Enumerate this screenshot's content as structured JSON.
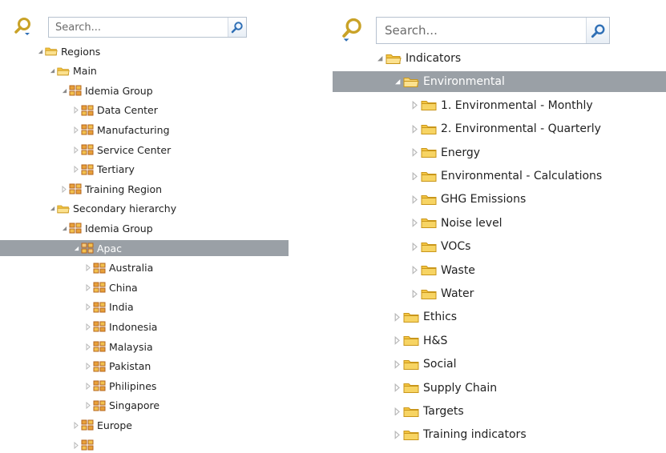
{
  "left": {
    "search": {
      "placeholder": "Search..."
    },
    "rows": [
      {
        "label": "Regions",
        "depth": 0,
        "expanded": true,
        "selected": false,
        "icon": "folder-open-icon"
      },
      {
        "label": "Main",
        "depth": 1,
        "expanded": true,
        "selected": false,
        "icon": "folder-open-icon"
      },
      {
        "label": "Idemia Group",
        "depth": 2,
        "expanded": true,
        "selected": false,
        "icon": "org-unit-icon"
      },
      {
        "label": "Data Center",
        "depth": 3,
        "expanded": false,
        "selected": false,
        "icon": "org-unit-icon"
      },
      {
        "label": "Manufacturing",
        "depth": 3,
        "expanded": false,
        "selected": false,
        "icon": "org-unit-icon"
      },
      {
        "label": "Service Center",
        "depth": 3,
        "expanded": false,
        "selected": false,
        "icon": "org-unit-icon"
      },
      {
        "label": "Tertiary",
        "depth": 3,
        "expanded": false,
        "selected": false,
        "icon": "org-unit-icon"
      },
      {
        "label": "Training Region",
        "depth": 2,
        "expanded": false,
        "selected": false,
        "icon": "org-unit-icon"
      },
      {
        "label": "Secondary hierarchy",
        "depth": 1,
        "expanded": true,
        "selected": false,
        "icon": "folder-open-icon"
      },
      {
        "label": "Idemia Group",
        "depth": 2,
        "expanded": true,
        "selected": false,
        "icon": "org-unit-icon"
      },
      {
        "label": "Apac",
        "depth": 3,
        "expanded": true,
        "selected": true,
        "icon": "org-unit-icon"
      },
      {
        "label": "Australia",
        "depth": 4,
        "expanded": false,
        "selected": false,
        "icon": "org-unit-icon"
      },
      {
        "label": "China",
        "depth": 4,
        "expanded": false,
        "selected": false,
        "icon": "org-unit-icon"
      },
      {
        "label": "India",
        "depth": 4,
        "expanded": false,
        "selected": false,
        "icon": "org-unit-icon"
      },
      {
        "label": "Indonesia",
        "depth": 4,
        "expanded": false,
        "selected": false,
        "icon": "org-unit-icon"
      },
      {
        "label": "Malaysia",
        "depth": 4,
        "expanded": false,
        "selected": false,
        "icon": "org-unit-icon"
      },
      {
        "label": "Pakistan",
        "depth": 4,
        "expanded": false,
        "selected": false,
        "icon": "org-unit-icon"
      },
      {
        "label": "Philipines",
        "depth": 4,
        "expanded": false,
        "selected": false,
        "icon": "org-unit-icon"
      },
      {
        "label": "Singapore",
        "depth": 4,
        "expanded": false,
        "selected": false,
        "icon": "org-unit-icon"
      },
      {
        "label": "Europe",
        "depth": 3,
        "expanded": false,
        "selected": false,
        "icon": "org-unit-icon"
      },
      {
        "label": "",
        "depth": 3,
        "expanded": false,
        "selected": false,
        "icon": "org-unit-icon"
      }
    ]
  },
  "right": {
    "search": {
      "placeholder": "Search..."
    },
    "rows": [
      {
        "label": "Indicators",
        "depth": 0,
        "expanded": true,
        "selected": false,
        "icon": "folder-open-icon"
      },
      {
        "label": "Environmental",
        "depth": 1,
        "expanded": true,
        "selected": true,
        "icon": "folder-open-icon"
      },
      {
        "label": "1. Environmental - Monthly",
        "depth": 2,
        "expanded": false,
        "selected": false,
        "icon": "folder-icon"
      },
      {
        "label": "2. Environmental - Quarterly",
        "depth": 2,
        "expanded": false,
        "selected": false,
        "icon": "folder-icon"
      },
      {
        "label": "Energy",
        "depth": 2,
        "expanded": false,
        "selected": false,
        "icon": "folder-icon"
      },
      {
        "label": "Environmental - Calculations",
        "depth": 2,
        "expanded": false,
        "selected": false,
        "icon": "folder-icon"
      },
      {
        "label": "GHG Emissions",
        "depth": 2,
        "expanded": false,
        "selected": false,
        "icon": "folder-icon"
      },
      {
        "label": "Noise level",
        "depth": 2,
        "expanded": false,
        "selected": false,
        "icon": "folder-icon"
      },
      {
        "label": "VOCs",
        "depth": 2,
        "expanded": false,
        "selected": false,
        "icon": "folder-icon"
      },
      {
        "label": "Waste",
        "depth": 2,
        "expanded": false,
        "selected": false,
        "icon": "folder-icon"
      },
      {
        "label": "Water",
        "depth": 2,
        "expanded": false,
        "selected": false,
        "icon": "folder-icon"
      },
      {
        "label": "Ethics",
        "depth": 1,
        "expanded": false,
        "selected": false,
        "icon": "folder-icon"
      },
      {
        "label": "H&S",
        "depth": 1,
        "expanded": false,
        "selected": false,
        "icon": "folder-icon"
      },
      {
        "label": "Social",
        "depth": 1,
        "expanded": false,
        "selected": false,
        "icon": "folder-icon"
      },
      {
        "label": "Supply Chain",
        "depth": 1,
        "expanded": false,
        "selected": false,
        "icon": "folder-icon"
      },
      {
        "label": "Targets",
        "depth": 1,
        "expanded": false,
        "selected": false,
        "icon": "folder-icon"
      },
      {
        "label": "Training indicators",
        "depth": 1,
        "expanded": false,
        "selected": false,
        "icon": "folder-icon"
      }
    ]
  },
  "colors": {
    "selection": "#9aa0a6",
    "folder": "#f4c542",
    "folder_edge": "#c9961a",
    "org_unit": "#e8a13a",
    "org_unit_edge": "#b5651d",
    "twisty": "#8a8a8a",
    "search_glass": "#2f6fb5",
    "search_tool": "#c9a227"
  },
  "icons": {
    "search_tool": "search-tool-icon",
    "search_button": "magnifier-icon",
    "expanded": "triangle-expanded-icon",
    "collapsed": "triangle-collapsed-icon"
  }
}
